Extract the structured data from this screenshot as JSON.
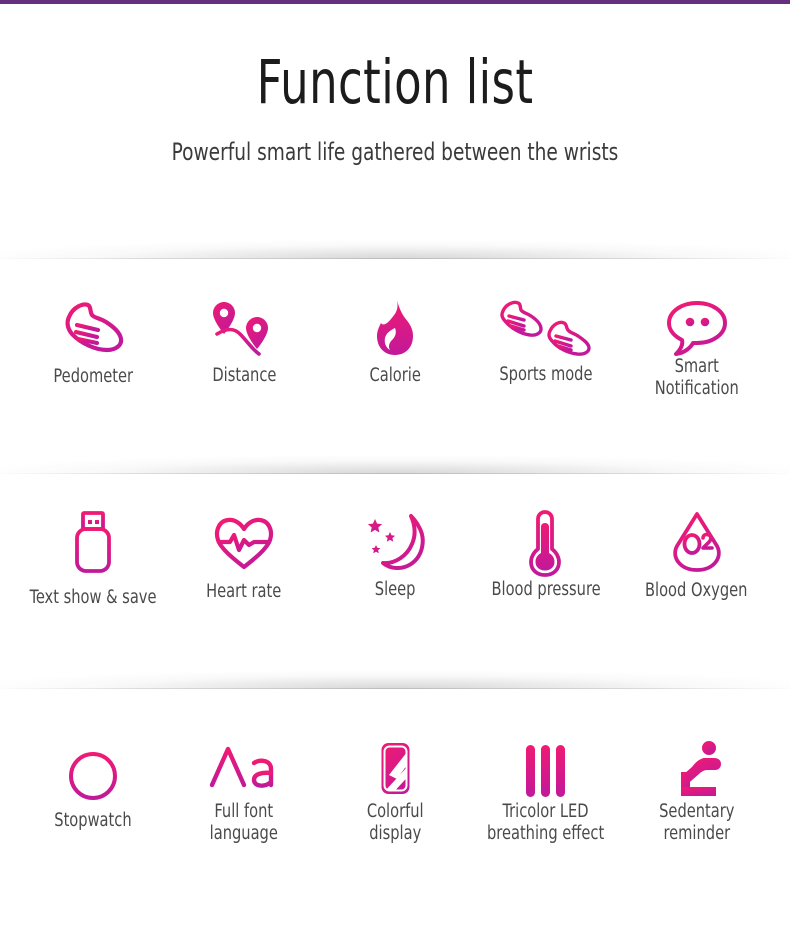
{
  "theme": {
    "top_rule_color": "#67307f",
    "accent_start": "#f01a73",
    "accent_end": "#c1199a",
    "label_color": "#4a4a4a",
    "title_color": "#1c1c1c",
    "background": "#ffffff"
  },
  "header": {
    "title": "Function list",
    "subtitle": "Powerful smart life gathered between the wrists"
  },
  "rows": [
    {
      "items": [
        {
          "icon": "running-shoe-icon",
          "label": "Pedometer"
        },
        {
          "icon": "route-pins-icon",
          "label": "Distance"
        },
        {
          "icon": "flame-icon",
          "label": "Calorie"
        },
        {
          "icon": "two-shoes-icon",
          "label": "Sports mode"
        },
        {
          "icon": "speech-bubble-icon",
          "label": "Smart\nNotification"
        }
      ]
    },
    {
      "items": [
        {
          "icon": "usb-drive-icon",
          "label": "Text show & save"
        },
        {
          "icon": "heart-pulse-icon",
          "label": "Heart rate"
        },
        {
          "icon": "moon-stars-icon",
          "label": "Sleep"
        },
        {
          "icon": "thermometer-icon",
          "label": "Blood pressure"
        },
        {
          "icon": "blood-drop-o2-icon",
          "label": "Blood Oxygen"
        }
      ]
    },
    {
      "items": [
        {
          "icon": "stopwatch-icon",
          "label": "Stopwatch"
        },
        {
          "icon": "font-aa-icon",
          "label": "Full font\nlanguage"
        },
        {
          "icon": "watch-band-icon",
          "label": "Colorful\ndisplay"
        },
        {
          "icon": "three-bars-icon",
          "label": "Tricolor LED\nbreathing effect"
        },
        {
          "icon": "sitting-person-icon",
          "label": "Sedentary\nreminder"
        }
      ]
    }
  ]
}
